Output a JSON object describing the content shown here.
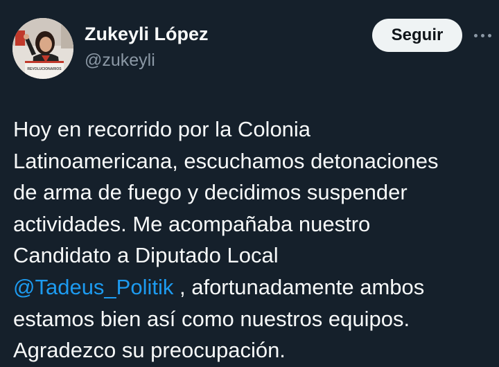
{
  "author": {
    "name": "Zukeyli López",
    "handle": "@zukeyli",
    "avatar_sign_text": "REVOLUCIONARIOS"
  },
  "follow_button": {
    "label": "Seguir"
  },
  "more_menu": {
    "icon": "more-horizontal-icon"
  },
  "tweet": {
    "lines": [
      "Hoy en recorrido por la Colonia",
      "Latinoamericana, escuchamos detonaciones",
      "de arma de fuego y decidimos suspender",
      "actividades. Me acompañaba nuestro",
      "Candidato a Diputado Local"
    ],
    "mention": "@Tadeus_Politik",
    "after_mention": " , afortunadamente ambos",
    "lines_end": [
      "estamos bien así como nuestros equipos.",
      "Agradezco su preocupación."
    ]
  },
  "colors": {
    "background": "#15202b",
    "text": "#f7f9f9",
    "secondary_text": "#8b98a5",
    "link": "#1d9bf0",
    "button_bg": "#eff3f4"
  }
}
